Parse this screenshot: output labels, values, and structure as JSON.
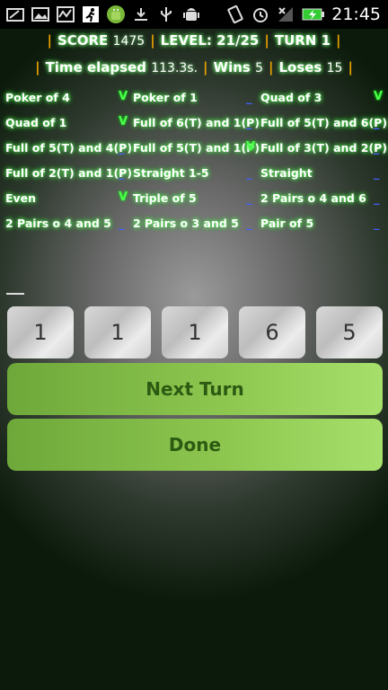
{
  "status_bar": {
    "time": "21:45",
    "left_icons": [
      "photo-edit-icon",
      "gallery-icon",
      "activity-icon",
      "running-icon",
      "android-icon",
      "download-icon",
      "usb-icon",
      "android-debug-icon"
    ],
    "right_icons": [
      "rotate-icon",
      "alarm-icon",
      "no-signal-icon",
      "battery-charging-icon"
    ]
  },
  "header": {
    "score_label": "SCORE",
    "score_value": "1475",
    "level_label": "LEVEL:",
    "level_value": "21/25",
    "turn_label": "TURN",
    "turn_value": "1",
    "time_label": "Time elapsed",
    "time_value": "113.3s.",
    "wins_label": "Wins",
    "wins_value": "5",
    "loses_label": "Loses",
    "loses_value": "15"
  },
  "goals": [
    [
      {
        "label": "Poker of 4",
        "mark": "V"
      },
      {
        "label": "Poker of 1",
        "mark": "_"
      },
      {
        "label": "Quad of 3",
        "mark": "V"
      }
    ],
    [
      {
        "label": "Quad of 1",
        "mark": "V"
      },
      {
        "label": "Full of 6(T) and 1(P)",
        "mark": "_"
      },
      {
        "label": "Full of 5(T) and 6(P)",
        "mark": "_"
      }
    ],
    [
      {
        "label": "Full of 5(T) and 4(P)",
        "mark": "_"
      },
      {
        "label": "Full of 5(T) and 1(P)",
        "mark": "V"
      },
      {
        "label": "Full of 3(T) and 2(P)",
        "mark": "_"
      }
    ],
    [
      {
        "label": "Full of 2(T) and 1(P)",
        "mark": "_"
      },
      {
        "label": "Straight 1-5",
        "mark": "_"
      },
      {
        "label": "Straight",
        "mark": "_"
      }
    ],
    [
      {
        "label": "Even",
        "mark": "V"
      },
      {
        "label": "Triple of 5",
        "mark": "_"
      },
      {
        "label": "2 Pairs o 4 and 6",
        "mark": "_"
      }
    ],
    [
      {
        "label": "2 Pairs o 4 and 5",
        "mark": "_"
      },
      {
        "label": "2 Pairs o 3 and 5",
        "mark": "_"
      },
      {
        "label": "Pair of 5",
        "mark": "_"
      }
    ]
  ],
  "dice": [
    "1",
    "1",
    "1",
    "6",
    "5"
  ],
  "buttons": {
    "next_turn": "Next Turn",
    "done": "Done"
  }
}
